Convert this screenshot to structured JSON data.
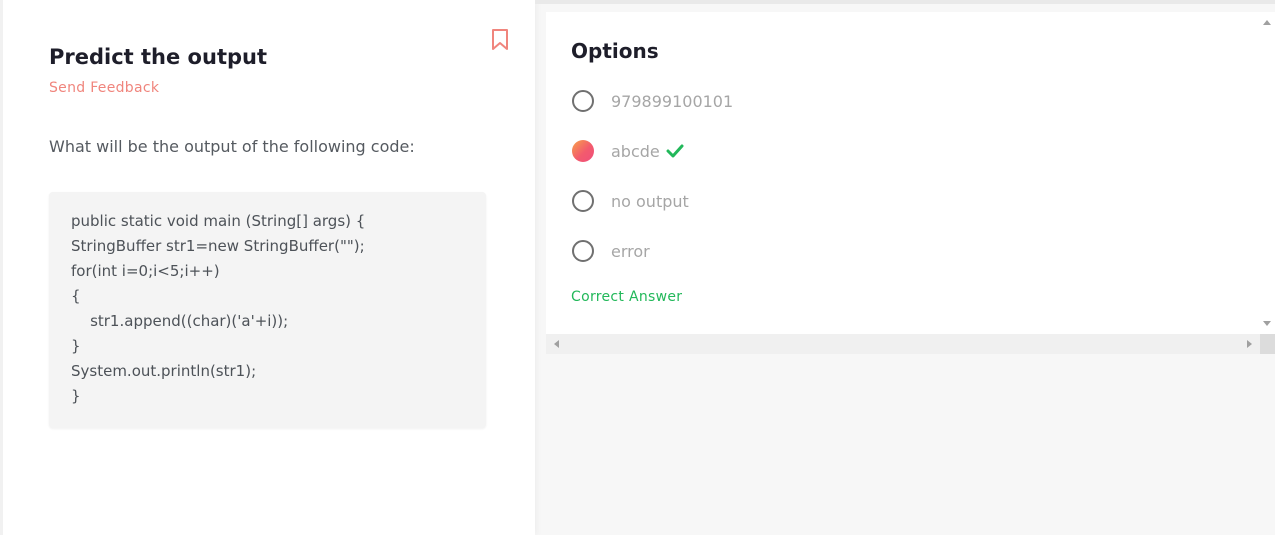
{
  "question": {
    "title": "Predict the output",
    "feedback_link": "Send Feedback",
    "prompt": "What will be the output of the following code:",
    "code_lines": [
      "public static void main (String[] args) {",
      "StringBuffer str1=new StringBuffer(\"\");",
      "for(int i=0;i<5;i++)",
      "{",
      "    str1.append((char)('a'+i));",
      "}",
      "System.out.println(str1);",
      "}"
    ]
  },
  "options": {
    "title": "Options",
    "items": [
      {
        "label": "979899100101",
        "selected": false,
        "correct": false
      },
      {
        "label": "abcde",
        "selected": true,
        "correct": true
      },
      {
        "label": "no output",
        "selected": false,
        "correct": false
      },
      {
        "label": "error",
        "selected": false,
        "correct": false
      }
    ],
    "result_text": "Correct Answer"
  },
  "icons": {
    "bookmark": "bookmark-icon",
    "check": "checkmark-icon"
  },
  "colors": {
    "accent": "#f0857d",
    "correct": "#22b85a",
    "selected_gradient_start": "#f7a24a",
    "selected_gradient_end": "#ef4e7b"
  }
}
